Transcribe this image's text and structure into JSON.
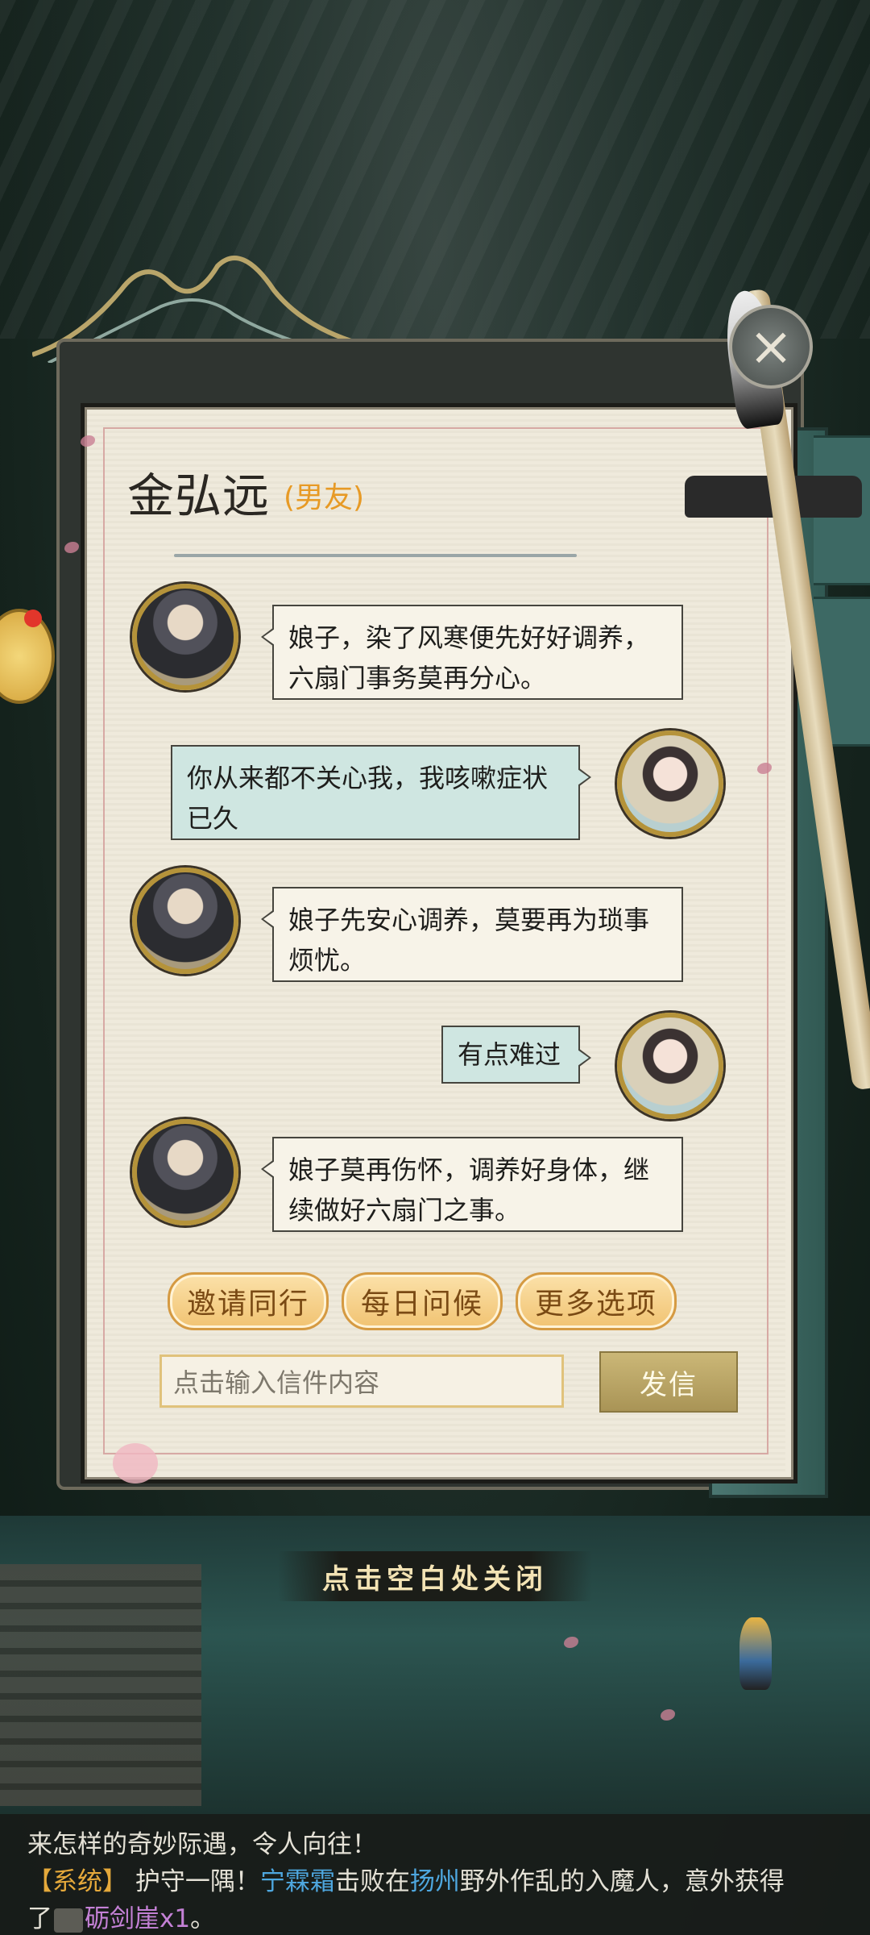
{
  "letter": {
    "sender_name": "金弘远",
    "relation": "(男友)",
    "messages": [
      {
        "side": "left",
        "speaker": "male",
        "lines": [
          "娘子，染了风寒便先好好调养，",
          "六扇门事务莫再分心。"
        ]
      },
      {
        "side": "right",
        "speaker": "female",
        "lines": [
          "你从来都不关心我，我咳嗽症状",
          "已久"
        ]
      },
      {
        "side": "left",
        "speaker": "male",
        "lines": [
          "娘子先安心调养，莫要再为琐事",
          "烦忧。"
        ]
      },
      {
        "side": "right",
        "speaker": "female",
        "lines": [
          "有点难过"
        ]
      },
      {
        "side": "left",
        "speaker": "male",
        "lines": [
          "娘子莫再伤怀，调养好身体，继",
          "续做好六扇门之事。"
        ]
      }
    ],
    "options": [
      "邀请同行",
      "每日问候",
      "更多选项"
    ],
    "input_placeholder": "点击输入信件内容",
    "send_label": "发信"
  },
  "close_hint": "点击空白处关闭",
  "log": {
    "line1": "来怎样的奇妙际遇，令人向往！",
    "line2_tag": "【系统】",
    "line2_a": "护守一隅！",
    "line2_name": "宁霖霜",
    "line2_b": "击败在",
    "line2_place": "扬州",
    "line2_c": "野外作乱的入魔人，意外获得",
    "line3_a": "了",
    "line3_item": "砺剑崖x1",
    "line3_b": "。"
  },
  "icons": {
    "close": "close-icon",
    "chat": "chat-bubble-icon",
    "item": "sword-item-icon"
  },
  "colors": {
    "relation": "#e79a25",
    "system_tag": "#e5a93b",
    "player_name": "#4ea7df",
    "item_name": "#c481d6"
  }
}
